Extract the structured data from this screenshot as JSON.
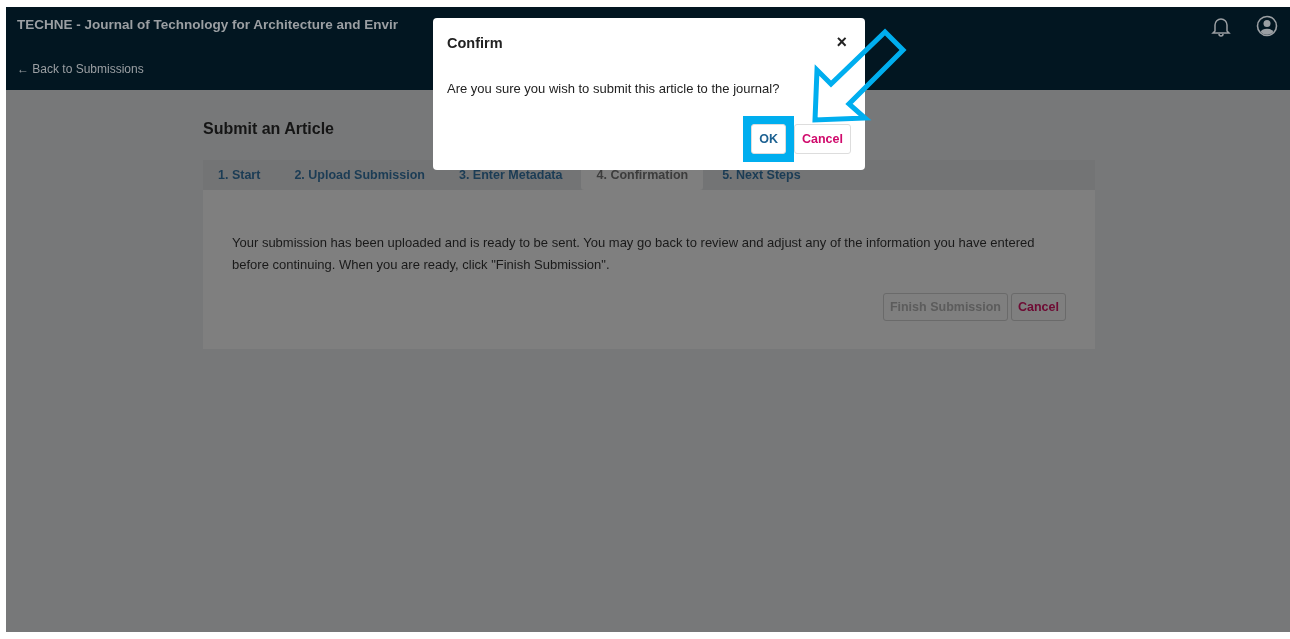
{
  "header": {
    "title": "TECHNE - Journal of Technology for Architecture and Envir",
    "back_link": "← Back to Submissions"
  },
  "page": {
    "heading": "Submit an Article",
    "tabs": [
      {
        "label": "1. Start",
        "selected": false
      },
      {
        "label": "2. Upload Submission",
        "selected": false
      },
      {
        "label": "3. Enter Metadata",
        "selected": false
      },
      {
        "label": "4. Confirmation",
        "selected": true
      },
      {
        "label": "5. Next Steps",
        "selected": false
      }
    ],
    "message": "Your submission has been uploaded and is ready to be sent. You may go back to review and adjust any of the information you have entered before continuing. When you are ready, click \"Finish Submission\".",
    "buttons": [
      {
        "label": "Finish Submission",
        "kind": "primary",
        "disabled": true
      },
      {
        "label": "Cancel",
        "kind": "danger",
        "disabled": false
      }
    ]
  },
  "dialog": {
    "title": "Confirm",
    "close": "×",
    "message": "Are you sure you wish to submit this article to the journal?",
    "buttons": [
      {
        "label": "OK",
        "kind": "primary",
        "highlighted": true
      },
      {
        "label": "Cancel",
        "kind": "danger",
        "highlighted": false
      }
    ]
  }
}
